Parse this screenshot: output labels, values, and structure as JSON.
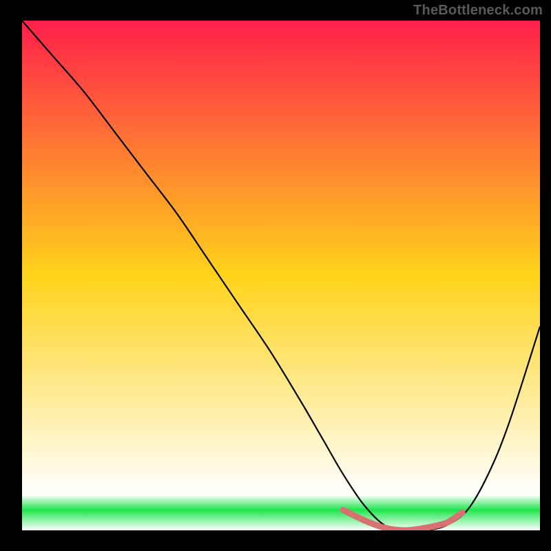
{
  "watermark": "TheBottleneck.com",
  "colors": {
    "top": "#ff1f4b",
    "mid": "#ffd31a",
    "green": "#1fe64d",
    "bottom": "#ffffff",
    "curve": "#000000",
    "accent": "#d87172",
    "frame": "#000000",
    "watermark_text": "#5a5a5a"
  },
  "chart_data": {
    "type": "line",
    "title": "",
    "xlabel": "",
    "ylabel": "",
    "xlim": [
      0,
      100
    ],
    "ylim": [
      0,
      100
    ],
    "grid": false,
    "legend": false,
    "series": [
      {
        "name": "bottleneck-curve",
        "x": [
          0,
          6,
          12,
          18,
          24,
          30,
          36,
          42,
          48,
          54,
          58,
          62,
          66,
          70,
          74,
          78,
          82,
          86,
          90,
          94,
          100
        ],
        "values": [
          100,
          93,
          86,
          78,
          70,
          62,
          53,
          44,
          35,
          25,
          18,
          11,
          5,
          1,
          0,
          0,
          1,
          4,
          11,
          21,
          40
        ]
      }
    ],
    "accent_segment": {
      "name": "optimal-range",
      "x": [
        62,
        66,
        70,
        74,
        78,
        82,
        85
      ],
      "values": [
        4,
        2,
        0.5,
        0,
        0.5,
        1.5,
        3.5
      ]
    }
  }
}
